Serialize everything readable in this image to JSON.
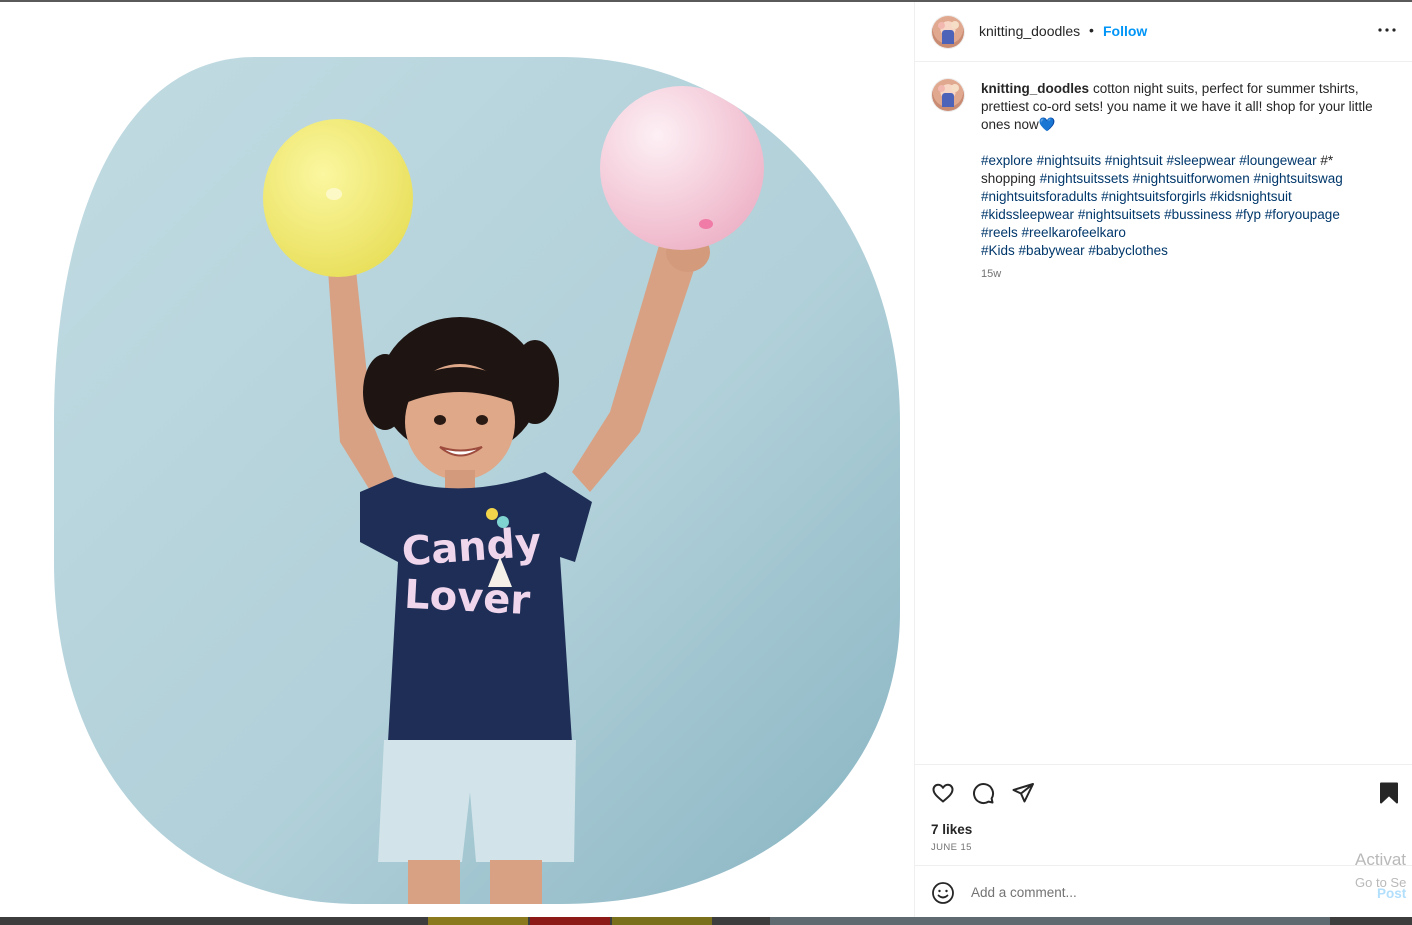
{
  "post": {
    "username": "knitting_doodles",
    "separator": "•",
    "follow_label": "Follow",
    "caption_username": "knitting_doodles",
    "caption_text": "cotton night suits, perfect for summer tshirts, prettiest co-ord sets! you name it we have it all! shop for your little ones now💙",
    "hashtags_line1": [
      "#explore",
      "#nightsuits",
      "#nightsuit",
      "#sleepwear",
      "#loungewear"
    ],
    "hashtags_line1_tail": "#*",
    "hashtags_line2_lead": "shopping",
    "hashtags_rest": [
      "#nightsuitssets",
      "#nightsuitforwomen",
      "#nightsuitswag",
      "#nightsuitsforadults",
      "#nightsuitsforgirls",
      "#kidsnightsuit",
      "#kidssleepwear",
      "#nightsuitsets",
      "#bussiness",
      "#fyp",
      "#foryoupage",
      "#reels",
      "#reelkarofeelkaro"
    ],
    "hashtags_last": [
      "#Kids",
      "#babywear",
      "#babyclothes"
    ],
    "age": "15w",
    "likes": "7 likes",
    "date": "JUNE 15",
    "comment_placeholder": "Add a comment...",
    "post_label": "Post"
  },
  "photo": {
    "shirt_text_line1": "Candy",
    "shirt_text_line2": "Lover"
  },
  "overlay": {
    "activate_line1": "Activat",
    "activate_line2": "Go to Se"
  },
  "icons": {
    "more": "more-options-icon",
    "like": "heart-icon",
    "comment": "comment-icon",
    "share": "share-icon",
    "save": "bookmark-icon",
    "emoji": "emoji-icon"
  },
  "colors": {
    "accent": "#0095f6",
    "hashtag": "#00376b",
    "photo_background": "#b3d2da",
    "shirt": "#1f2e57",
    "balloon_yellow": "#f0ea74",
    "balloon_pink": "#f3c6d6"
  }
}
